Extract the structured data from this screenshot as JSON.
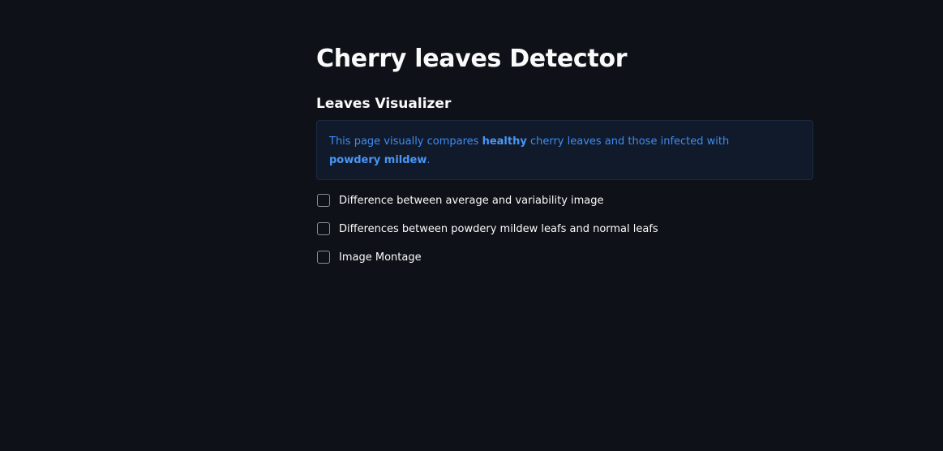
{
  "page": {
    "title": "Cherry leaves Detector",
    "subheader": "Leaves Visualizer"
  },
  "info": {
    "text_before_1": "This page visually compares ",
    "bold_1": "healthy",
    "text_between": " cherry leaves and those infected with ",
    "bold_2": "powdery mildew",
    "text_after": "."
  },
  "checkboxes": [
    {
      "label": "Difference between average and variability image",
      "checked": false
    },
    {
      "label": "Differences between powdery mildew leafs and normal leafs",
      "checked": false
    },
    {
      "label": "Image Montage",
      "checked": false
    }
  ],
  "colors": {
    "background": "#0e1117",
    "text": "#fafafa",
    "info_background": "#111a2b",
    "info_text": "#3d8cf0"
  }
}
